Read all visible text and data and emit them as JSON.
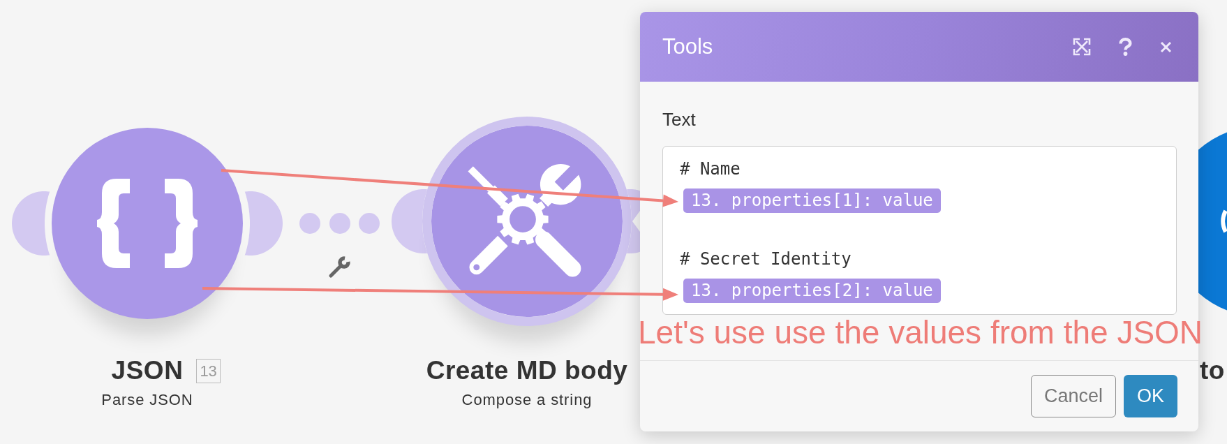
{
  "canvas": {
    "nodes": [
      {
        "kind": "json",
        "title": "JSON",
        "badge": "13",
        "subtitle": "Parse JSON",
        "selected": false,
        "color": "#aa97e8"
      },
      {
        "kind": "tools",
        "title": "Create MD body",
        "subtitle": "Compose a string",
        "selected": true,
        "color": "#a794e6"
      },
      {
        "kind": "cut-off",
        "title": "to",
        "selected": false,
        "color": "#0b78d4"
      }
    ]
  },
  "dialog": {
    "title": "Tools",
    "field": {
      "label": "Text",
      "sections": [
        {
          "heading": "# Name",
          "token": "13. properties[1]: value"
        },
        {
          "heading": "# Secret Identity",
          "token": "13. properties[2]: value"
        }
      ]
    },
    "buttons": [
      {
        "kind": "cancel",
        "label": "Cancel"
      },
      {
        "kind": "confirm",
        "label": "OK"
      }
    ]
  },
  "annotation": {
    "text": "Let's use use the values from the JSON"
  }
}
